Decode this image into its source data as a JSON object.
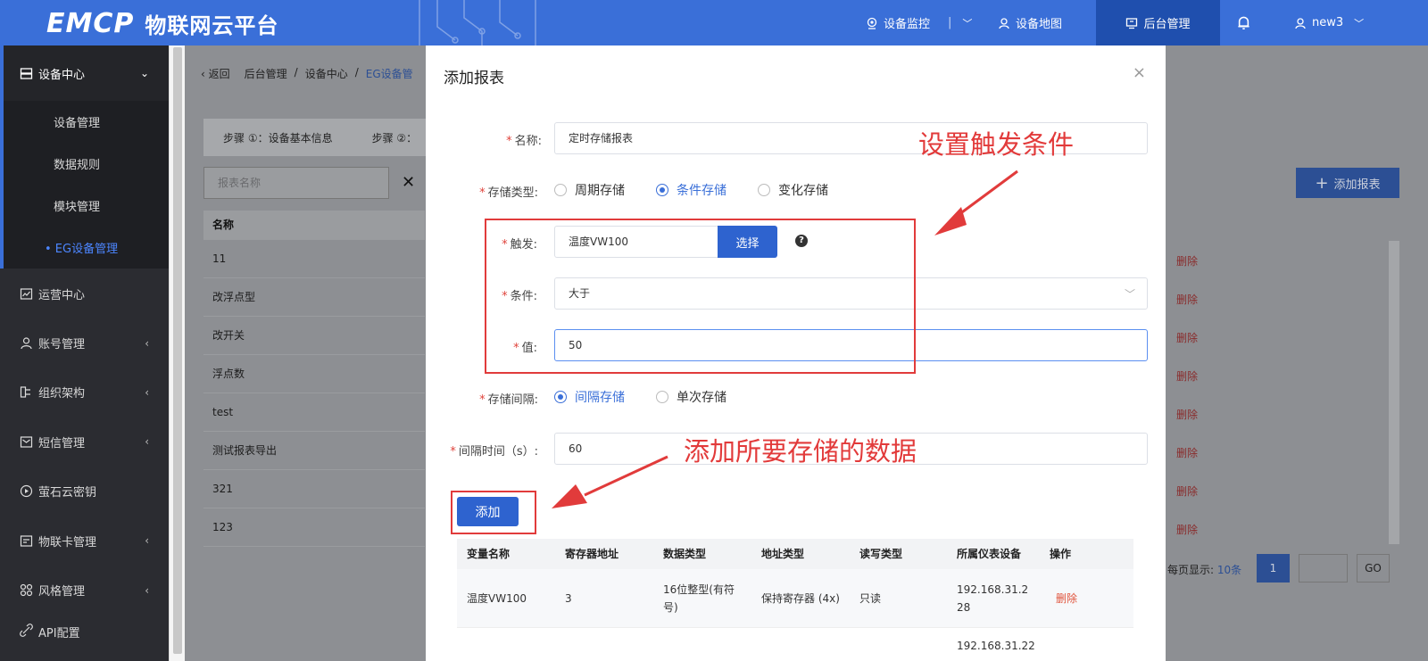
{
  "header": {
    "logo_mark": "EMCP",
    "logo_text": "物联网云平台",
    "nav": [
      {
        "label": "设备监控"
      },
      {
        "label": "设备地图"
      },
      {
        "label": "后台管理"
      },
      {
        "label": "new3"
      }
    ]
  },
  "sidebar": {
    "device_center": "设备中心",
    "sub_items": [
      "设备管理",
      "数据规则",
      "模块管理",
      "• EG设备管理"
    ],
    "groups": [
      "运营中心",
      "账号管理",
      "组织架构",
      "短信管理",
      "萤石云密钥",
      "物联卡管理",
      "风格管理",
      "API配置"
    ]
  },
  "background": {
    "breadcrumb": {
      "back": "返回",
      "items": [
        "后台管理",
        "/",
        "设备中心",
        "/",
        "EG设备管"
      ]
    },
    "steps": [
      "步骤 ①：设备基本信息",
      "步骤 ②："
    ],
    "search_placeholder": "报表名称",
    "add_report_button": "添加报表",
    "table_header": "名称",
    "rows": [
      "11",
      "改浮点型",
      "改开关",
      "浮点数",
      "test",
      "测试报表导出",
      "321",
      "123"
    ],
    "delete_label": "删除",
    "pager": {
      "per_page": "每页显示:",
      "per_page_value": "10条",
      "current_page": "1",
      "go": "GO"
    }
  },
  "modal": {
    "title": "添加报表",
    "close": "×",
    "fields": {
      "name_label": "名称:",
      "name_value": "定时存储报表",
      "storage_type_label": "存储类型:",
      "storage_types": [
        "周期存储",
        "条件存储",
        "变化存储"
      ],
      "trigger_label": "触发:",
      "trigger_value": "温度VW100",
      "select_button": "选择",
      "condition_label": "条件:",
      "condition_value": "大于",
      "value_label": "值:",
      "value_value": "50",
      "interval_label": "存储间隔:",
      "interval_types": [
        "间隔存储",
        "单次存储"
      ],
      "interval_time_label": "间隔时间（s）:",
      "interval_time_value": "60"
    },
    "add_button": "添加",
    "annotations": {
      "trigger": "设置触发条件",
      "add": "添加所要存储的数据"
    },
    "table": {
      "headers": [
        "变量名称",
        "寄存器地址",
        "数据类型",
        "地址类型",
        "读写类型",
        "所属仪表设备",
        "操作"
      ],
      "rows": [
        {
          "name": "温度VW100",
          "address": "3",
          "data_type": "16位整型(有符号)",
          "addr_type": "保持寄存器 (4x)",
          "rw": "只读",
          "device": "192.168.31.228",
          "action": "删除"
        }
      ],
      "partial_row_device": "192.168.31.22"
    }
  },
  "colors": {
    "brand": "#3a6fd8",
    "annotation_red": "#e13b3b",
    "delete_red": "#e0533b"
  }
}
